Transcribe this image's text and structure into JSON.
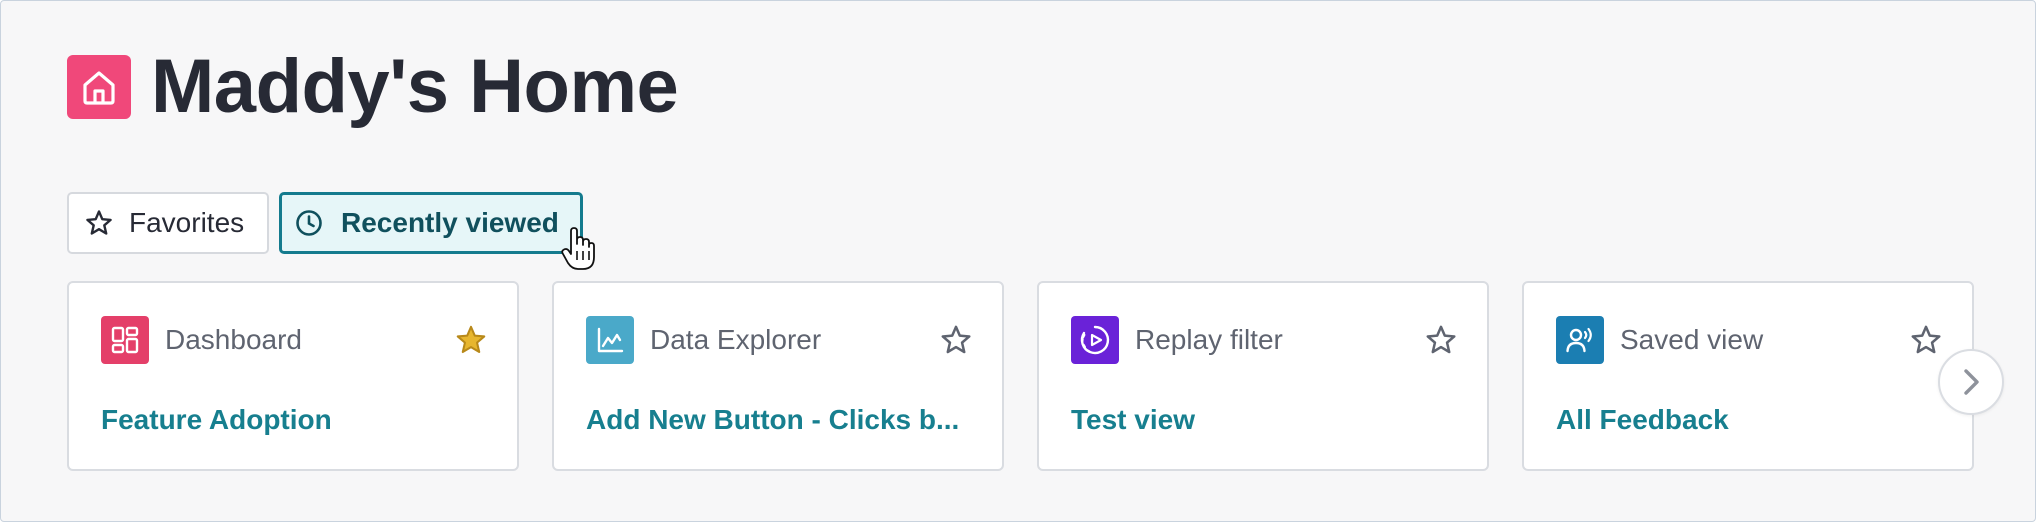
{
  "header": {
    "title": "Maddy's Home",
    "icon": "home-icon",
    "icon_color": "#f0487a"
  },
  "tabs": [
    {
      "label": "Favorites",
      "icon": "star-outline-icon",
      "selected": false
    },
    {
      "label": "Recently viewed",
      "icon": "clock-icon",
      "selected": true
    }
  ],
  "cards": [
    {
      "type": "Dashboard",
      "icon": "dashboard-icon",
      "icon_color": "#e43f69",
      "title": "Feature Adoption",
      "favorited": true
    },
    {
      "type": "Data Explorer",
      "icon": "chart-icon",
      "icon_color": "#4aa9c9",
      "title": "Add New Button - Clicks b...",
      "favorited": false
    },
    {
      "type": "Replay filter",
      "icon": "replay-icon",
      "icon_color": "#6a22d8",
      "title": "Test view",
      "favorited": false
    },
    {
      "type": "Saved view",
      "icon": "feedback-user-icon",
      "icon_color": "#1b7eb2",
      "title": "All Feedback",
      "favorited": false
    }
  ],
  "colors": {
    "accent": "#147b8e",
    "link": "#177f8f",
    "star_filled": "#e0b12c"
  }
}
